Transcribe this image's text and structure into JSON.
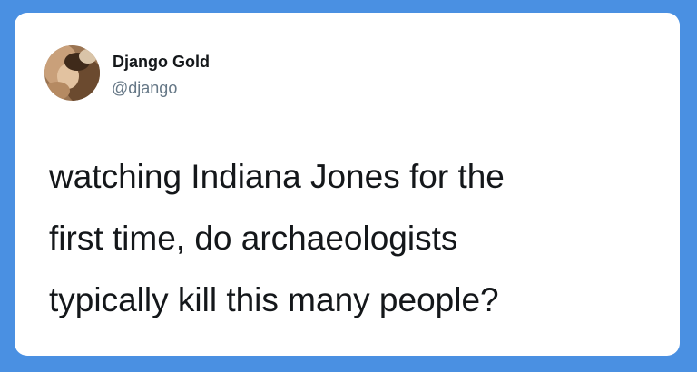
{
  "tweet": {
    "author": {
      "display_name": "Django Gold",
      "handle": "@django",
      "avatar_icon": "profile-photo"
    },
    "text_lines": [
      "watching Indiana Jones for the",
      "first time, do archaeologists",
      "typically kill this many people?"
    ]
  },
  "colors": {
    "page_background": "#4a90e2",
    "card_background": "#ffffff",
    "text_primary": "#14171a",
    "text_secondary": "#657786"
  }
}
